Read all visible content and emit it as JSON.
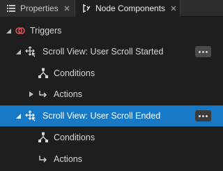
{
  "tabs": [
    {
      "label": "Properties",
      "icon": "properties-list-icon",
      "active": false
    },
    {
      "label": "Node Components",
      "icon": "node-components-icon",
      "active": true
    }
  ],
  "tree": {
    "triggers_label": "Triggers",
    "items": [
      {
        "label": "Scroll View: User Scroll Started",
        "expanded": true,
        "selected": false
      },
      {
        "label": "Conditions"
      },
      {
        "label": "Actions",
        "expanded": false
      },
      {
        "label": "Scroll View: User Scroll Ended",
        "expanded": true,
        "selected": true
      },
      {
        "label": "Conditions"
      },
      {
        "label": "Actions"
      }
    ]
  },
  "colors": {
    "selection": "#1778c6",
    "background": "#1e1e1e",
    "trigger_icon": "#e0525a"
  }
}
